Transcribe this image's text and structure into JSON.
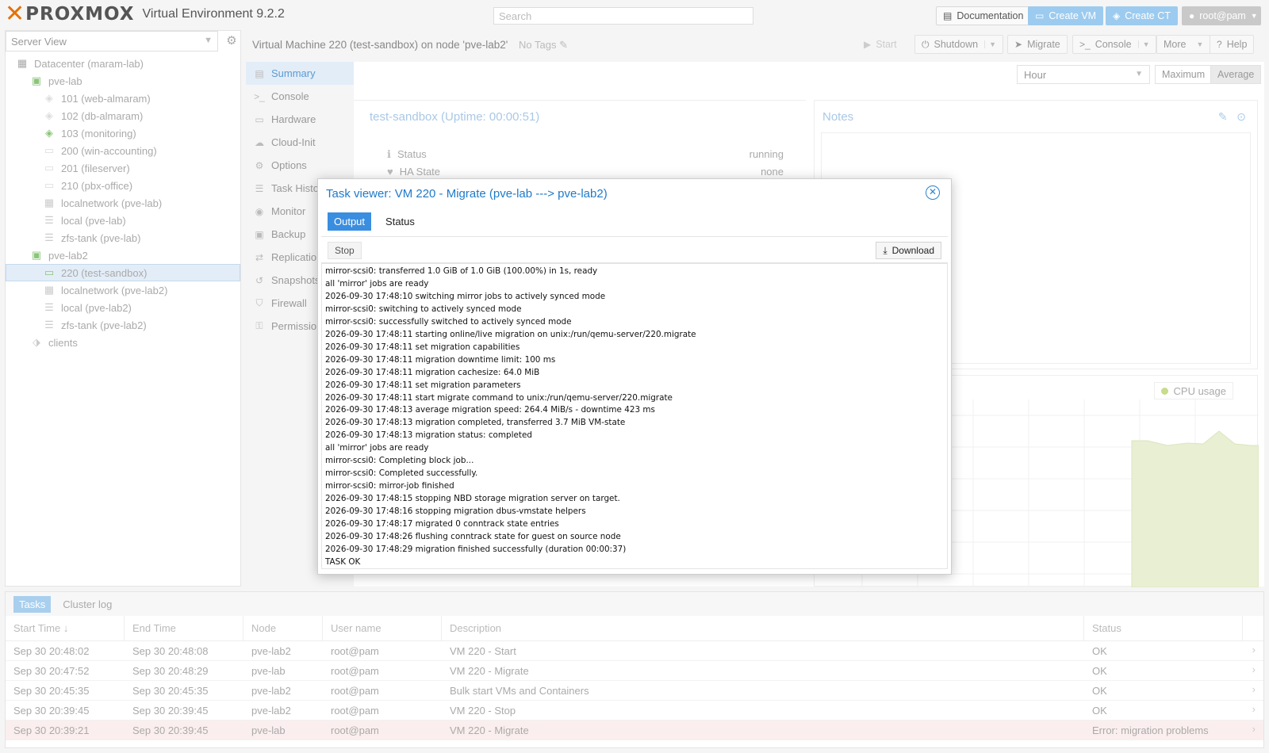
{
  "app": {
    "brand": "PROXMOX",
    "version_label": "Virtual Environment 9.2.2",
    "search_placeholder": "Search",
    "documentation": "Documentation",
    "create_vm": "Create VM",
    "create_ct": "Create CT",
    "user": "root@pam"
  },
  "tree": {
    "view_label": "Server View",
    "items": [
      {
        "label": "Datacenter (maram-lab)",
        "icon": "datacenter-icon"
      },
      {
        "label": "pve-lab",
        "icon": "node-online-icon"
      },
      {
        "label": "101 (web-almaram)",
        "icon": "container-icon"
      },
      {
        "label": "102 (db-almaram)",
        "icon": "container-icon"
      },
      {
        "label": "103 (monitoring)",
        "icon": "container-running-icon"
      },
      {
        "label": "200 (win-accounting)",
        "icon": "vm-icon"
      },
      {
        "label": "201 (fileserver)",
        "icon": "vm-icon"
      },
      {
        "label": "210 (pbx-office)",
        "icon": "vm-icon"
      },
      {
        "label": "localnetwork (pve-lab)",
        "icon": "network-grid-icon"
      },
      {
        "label": "local (pve-lab)",
        "icon": "storage-icon"
      },
      {
        "label": "zfs-tank (pve-lab)",
        "icon": "storage-icon"
      },
      {
        "label": "pve-lab2",
        "icon": "node-online-icon"
      },
      {
        "label": "220 (test-sandbox)",
        "icon": "vm-running-icon"
      },
      {
        "label": "localnetwork (pve-lab2)",
        "icon": "network-grid-icon"
      },
      {
        "label": "local (pve-lab2)",
        "icon": "storage-icon"
      },
      {
        "label": "zfs-tank (pve-lab2)",
        "icon": "storage-icon"
      },
      {
        "label": "clients",
        "icon": "tags-icon"
      }
    ]
  },
  "header": {
    "title": "Virtual Machine 220 (test-sandbox) on node 'pve-lab2'",
    "no_tags": "No Tags",
    "start": "Start",
    "shutdown": "Shutdown",
    "migrate": "Migrate",
    "console": "Console",
    "more": "More",
    "help": "Help"
  },
  "subnav": [
    {
      "label": "Summary",
      "icon": "book-icon"
    },
    {
      "label": "Console",
      "icon": "terminal-icon"
    },
    {
      "label": "Hardware",
      "icon": "monitor-icon"
    },
    {
      "label": "Cloud-Init",
      "icon": "cloud-icon"
    },
    {
      "label": "Options",
      "icon": "gear-icon"
    },
    {
      "label": "Task History",
      "icon": "list-icon"
    },
    {
      "label": "Monitor",
      "icon": "eye-icon"
    },
    {
      "label": "Backup",
      "icon": "floppy-icon"
    },
    {
      "label": "Replication",
      "icon": "retweet-icon"
    },
    {
      "label": "Snapshots",
      "icon": "history-icon"
    },
    {
      "label": "Firewall",
      "icon": "shield-icon"
    },
    {
      "label": "Permissions",
      "icon": "unlock-icon"
    }
  ],
  "summary": {
    "timeframe": "Hour",
    "maximum": "Maximum",
    "average": "Average",
    "title": "test-sandbox (Uptime: 00:00:51)",
    "status_label": "Status",
    "status_value": "running",
    "ha_label": "HA State",
    "ha_value": "none",
    "notes_title": "Notes",
    "cpu_legend": "CPU usage"
  },
  "bottom": {
    "tabs": [
      "Tasks",
      "Cluster log"
    ],
    "columns": [
      "Start Time",
      "End Time",
      "Node",
      "User name",
      "Description",
      "Status"
    ],
    "rows": [
      {
        "start": "Sep 30 20:48:02",
        "end": "Sep 30 20:48:08",
        "node": "pve-lab2",
        "user": "root@pam",
        "desc": "VM 220 - Start",
        "status": "OK"
      },
      {
        "start": "Sep 30 20:47:52",
        "end": "Sep 30 20:48:29",
        "node": "pve-lab",
        "user": "root@pam",
        "desc": "VM 220 - Migrate",
        "status": "OK"
      },
      {
        "start": "Sep 30 20:45:35",
        "end": "Sep 30 20:45:35",
        "node": "pve-lab2",
        "user": "root@pam",
        "desc": "Bulk start VMs and Containers",
        "status": "OK"
      },
      {
        "start": "Sep 30 20:39:45",
        "end": "Sep 30 20:39:45",
        "node": "pve-lab2",
        "user": "root@pam",
        "desc": "VM 220 - Stop",
        "status": "OK"
      },
      {
        "start": "Sep 30 20:39:21",
        "end": "Sep 30 20:39:45",
        "node": "pve-lab",
        "user": "root@pam",
        "desc": "VM 220 - Migrate",
        "status": "Error: migration problems"
      }
    ]
  },
  "modal": {
    "title": "Task viewer: VM 220 - Migrate (pve-lab ---> pve-lab2)",
    "tab_output": "Output",
    "tab_status": "Status",
    "stop": "Stop",
    "download": "Download",
    "log": [
      "mirror-scsi0: transferred 1.0 GiB of 1.0 GiB (100.00%) in 1s, ready",
      "all 'mirror' jobs are ready",
      "2026-09-30 17:48:10 switching mirror jobs to actively synced mode",
      "mirror-scsi0: switching to actively synced mode",
      "mirror-scsi0: successfully switched to actively synced mode",
      "2026-09-30 17:48:11 starting online/live migration on unix:/run/qemu-server/220.migrate",
      "2026-09-30 17:48:11 set migration capabilities",
      "2026-09-30 17:48:11 migration downtime limit: 100 ms",
      "2026-09-30 17:48:11 migration cachesize: 64.0 MiB",
      "2026-09-30 17:48:11 set migration parameters",
      "2026-09-30 17:48:11 start migrate command to unix:/run/qemu-server/220.migrate",
      "2026-09-30 17:48:13 average migration speed: 264.4 MiB/s - downtime 423 ms",
      "2026-09-30 17:48:13 migration completed, transferred 3.7 MiB VM-state",
      "2026-09-30 17:48:13 migration status: completed",
      "all 'mirror' jobs are ready",
      "mirror-scsi0: Completing block job...",
      "mirror-scsi0: Completed successfully.",
      "mirror-scsi0: mirror-job finished",
      "2026-09-30 17:48:15 stopping NBD storage migration server on target.",
      "2026-09-30 17:48:16 stopping migration dbus-vmstate helpers",
      "2026-09-30 17:48:17 migrated 0 conntrack state entries",
      "2026-09-30 17:48:26 flushing conntrack state for guest on source node",
      "2026-09-30 17:48:29 migration finished successfully (duration 00:00:37)",
      "TASK OK"
    ]
  },
  "colors": {
    "accent": "#3a8ee0",
    "brand_orange": "#e57000",
    "error_row": "#fbeeee",
    "cpu_fill": "#e8efd2"
  }
}
